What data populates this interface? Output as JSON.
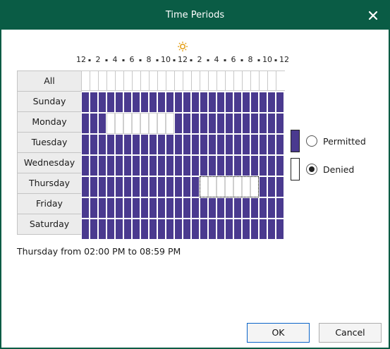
{
  "window": {
    "title": "Time Periods",
    "close_icon": "close-icon"
  },
  "hours": {
    "labels": [
      "12",
      "2",
      "4",
      "6",
      "8",
      "10",
      "12",
      "2",
      "4",
      "6",
      "8",
      "10",
      "12"
    ],
    "icons": [
      "moon-icon",
      "sun-icon",
      "moon-icon"
    ],
    "icon_colors": {
      "moon": "#0a6ec8",
      "sun": "#e5a11d"
    }
  },
  "days": {
    "all_label": "All",
    "rows": [
      "Sunday",
      "Monday",
      "Tuesday",
      "Wednesday",
      "Thursday",
      "Friday",
      "Saturday"
    ]
  },
  "schedule": {
    "permitted_color": "#4a3a8f",
    "denied_color": "#ffffff",
    "denied_ranges": [
      {
        "day": "Monday",
        "from_hour": 3,
        "to_hour": 10
      },
      {
        "day": "Thursday",
        "from_hour": 14,
        "to_hour": 20
      }
    ],
    "selected": {
      "day": "Thursday",
      "from_hour": 14,
      "to_hour": 20
    }
  },
  "legend": {
    "permitted_label": "Permitted",
    "denied_label": "Denied",
    "selected_option": "Denied"
  },
  "status_text": "Thursday from 02:00 PM to 08:59 PM",
  "buttons": {
    "ok": "OK",
    "cancel": "Cancel"
  }
}
